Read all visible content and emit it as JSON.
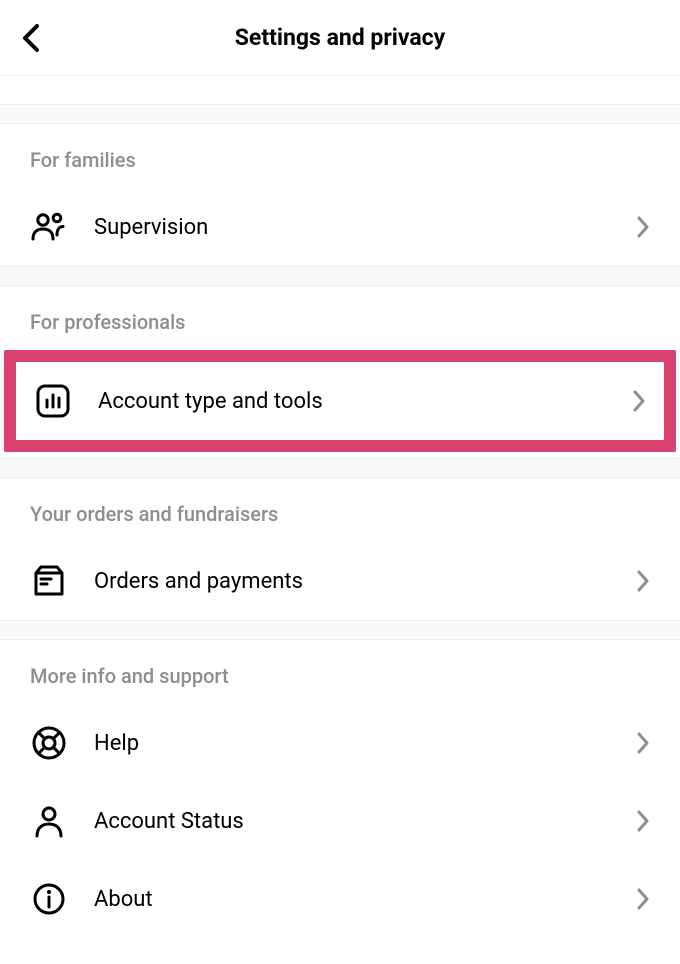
{
  "header": {
    "title": "Settings and privacy"
  },
  "sections": {
    "families": {
      "header": "For families",
      "items": {
        "supervision": "Supervision"
      }
    },
    "professionals": {
      "header": "For professionals",
      "items": {
        "account_type_tools": "Account type and tools"
      }
    },
    "orders": {
      "header": "Your orders and fundraisers",
      "items": {
        "orders_payments": "Orders and payments"
      }
    },
    "support": {
      "header": "More info and support",
      "items": {
        "help": "Help",
        "account_status": "Account Status",
        "about": "About"
      }
    }
  }
}
